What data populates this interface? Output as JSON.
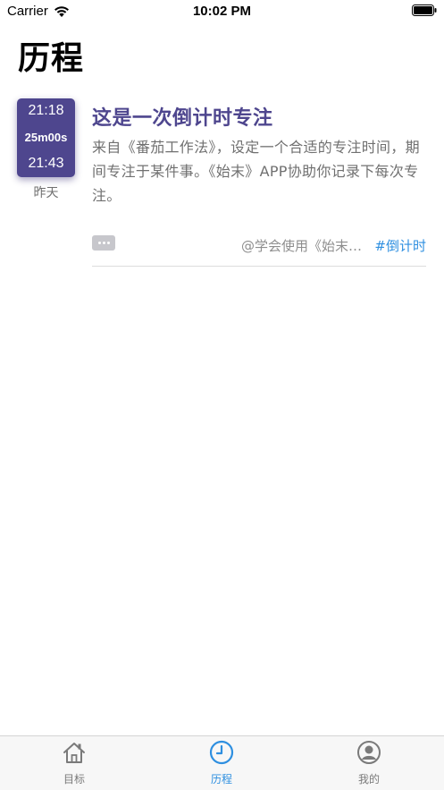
{
  "status_bar": {
    "carrier": "Carrier",
    "time": "10:02 PM"
  },
  "page": {
    "title": "历程"
  },
  "entries": [
    {
      "start_time": "21:18",
      "duration": "25m00s",
      "end_time": "21:43",
      "day": "昨天",
      "title": "这是一次倒计时专注",
      "description": "来自《番茄工作法》，设定一个合适的专注时间，期间专注于某件事。《始末》APP协助你记录下每次专注。",
      "source": "@学会使用《始末…",
      "tag": "#倒计时",
      "card_color": "#4e468e"
    }
  ],
  "tab_bar": {
    "tabs": [
      {
        "label": "目标",
        "icon": "house-icon",
        "active": false
      },
      {
        "label": "历程",
        "icon": "clock-icon",
        "active": true
      },
      {
        "label": "我的",
        "icon": "person-icon",
        "active": false
      }
    ]
  },
  "colors": {
    "accent": "#4e468e",
    "tab_active": "#2e8fe0",
    "tag": "#2e8fe0"
  }
}
